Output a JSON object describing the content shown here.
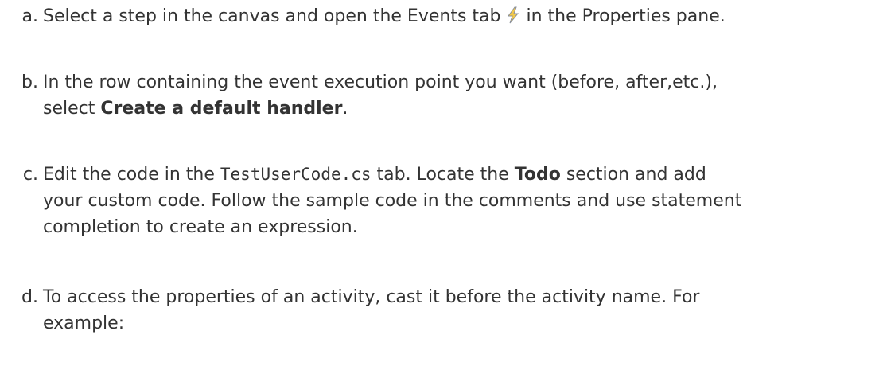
{
  "steps": [
    {
      "letter": "a.",
      "text1": "Select a step in the canvas and open the Events tab",
      "icon": "lightning-bolt-icon",
      "text2": "in the Properties pane."
    },
    {
      "letter": "b.",
      "text1": "In the row containing the event execution point you want (before, after,etc.),",
      "text2": "select ",
      "bold": "Create a default handler",
      "text3": "."
    },
    {
      "letter": "c.",
      "text1": "Edit the code in the ",
      "code": "TestUserCode.cs",
      "text2": " tab. Locate the ",
      "bold": "Todo",
      "text3": " section and add",
      "text4": "your custom code. Follow the sample code in the comments and use statement",
      "text5": "completion to create an expression."
    },
    {
      "letter": "d.",
      "text1": "To access the properties of an activity, cast it before the activity name. For",
      "text2": "example:"
    }
  ]
}
